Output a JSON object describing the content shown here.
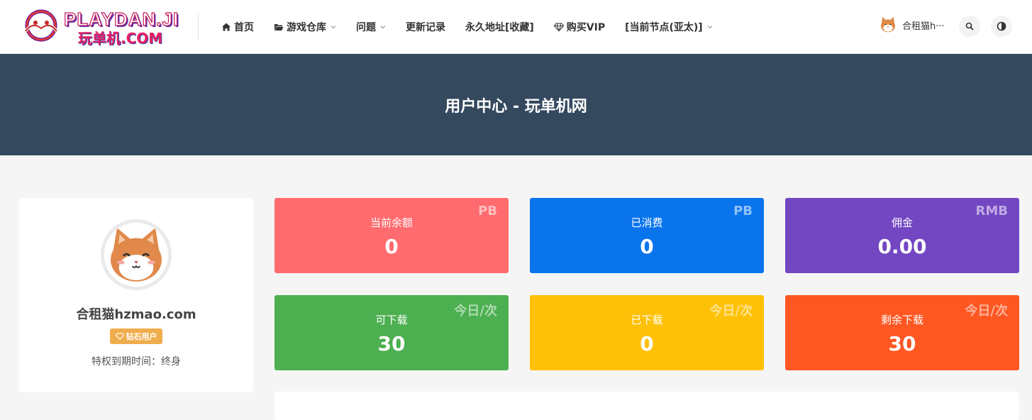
{
  "logo": {
    "top_text": "PLAYDAN.JI",
    "bottom_text": "玩单机.COM"
  },
  "nav": {
    "items": [
      {
        "label": "首页",
        "icon": "home-icon",
        "has_dropdown": false
      },
      {
        "label": "游戏仓库",
        "icon": "folder-open-icon",
        "has_dropdown": true
      },
      {
        "label": "问题",
        "icon": "",
        "has_dropdown": true
      },
      {
        "label": "更新记录",
        "icon": "",
        "has_dropdown": false
      },
      {
        "label": "永久地址[收藏]",
        "icon": "",
        "has_dropdown": false
      },
      {
        "label": "购买VIP",
        "icon": "diamond-icon",
        "has_dropdown": false
      },
      {
        "label": "[当前节点(亚太)]",
        "icon": "",
        "has_dropdown": true
      }
    ]
  },
  "user": {
    "name_truncated": "合租猫h···"
  },
  "banner": {
    "title": "用户中心 - 玩单机网"
  },
  "profile": {
    "name": "合租猫hzmao.com",
    "badge": "钻石用户",
    "expire": "特权到期时间：终身"
  },
  "stats": [
    {
      "label": "当前余额",
      "value": "0",
      "unit": "PB",
      "color": "#ff6b6e"
    },
    {
      "label": "已消费",
      "value": "0",
      "unit": "PB",
      "color": "#0a74ec"
    },
    {
      "label": "佣金",
      "value": "0.00",
      "unit": "RMB",
      "color": "#7346c2"
    },
    {
      "label": "可下载",
      "value": "30",
      "unit": "今日/次",
      "color": "#4caf50"
    },
    {
      "label": "已下载",
      "value": "0",
      "unit": "今日/次",
      "color": "#ffc107"
    },
    {
      "label": "剩余下载",
      "value": "30",
      "unit": "今日/次",
      "color": "#ff5722"
    }
  ]
}
